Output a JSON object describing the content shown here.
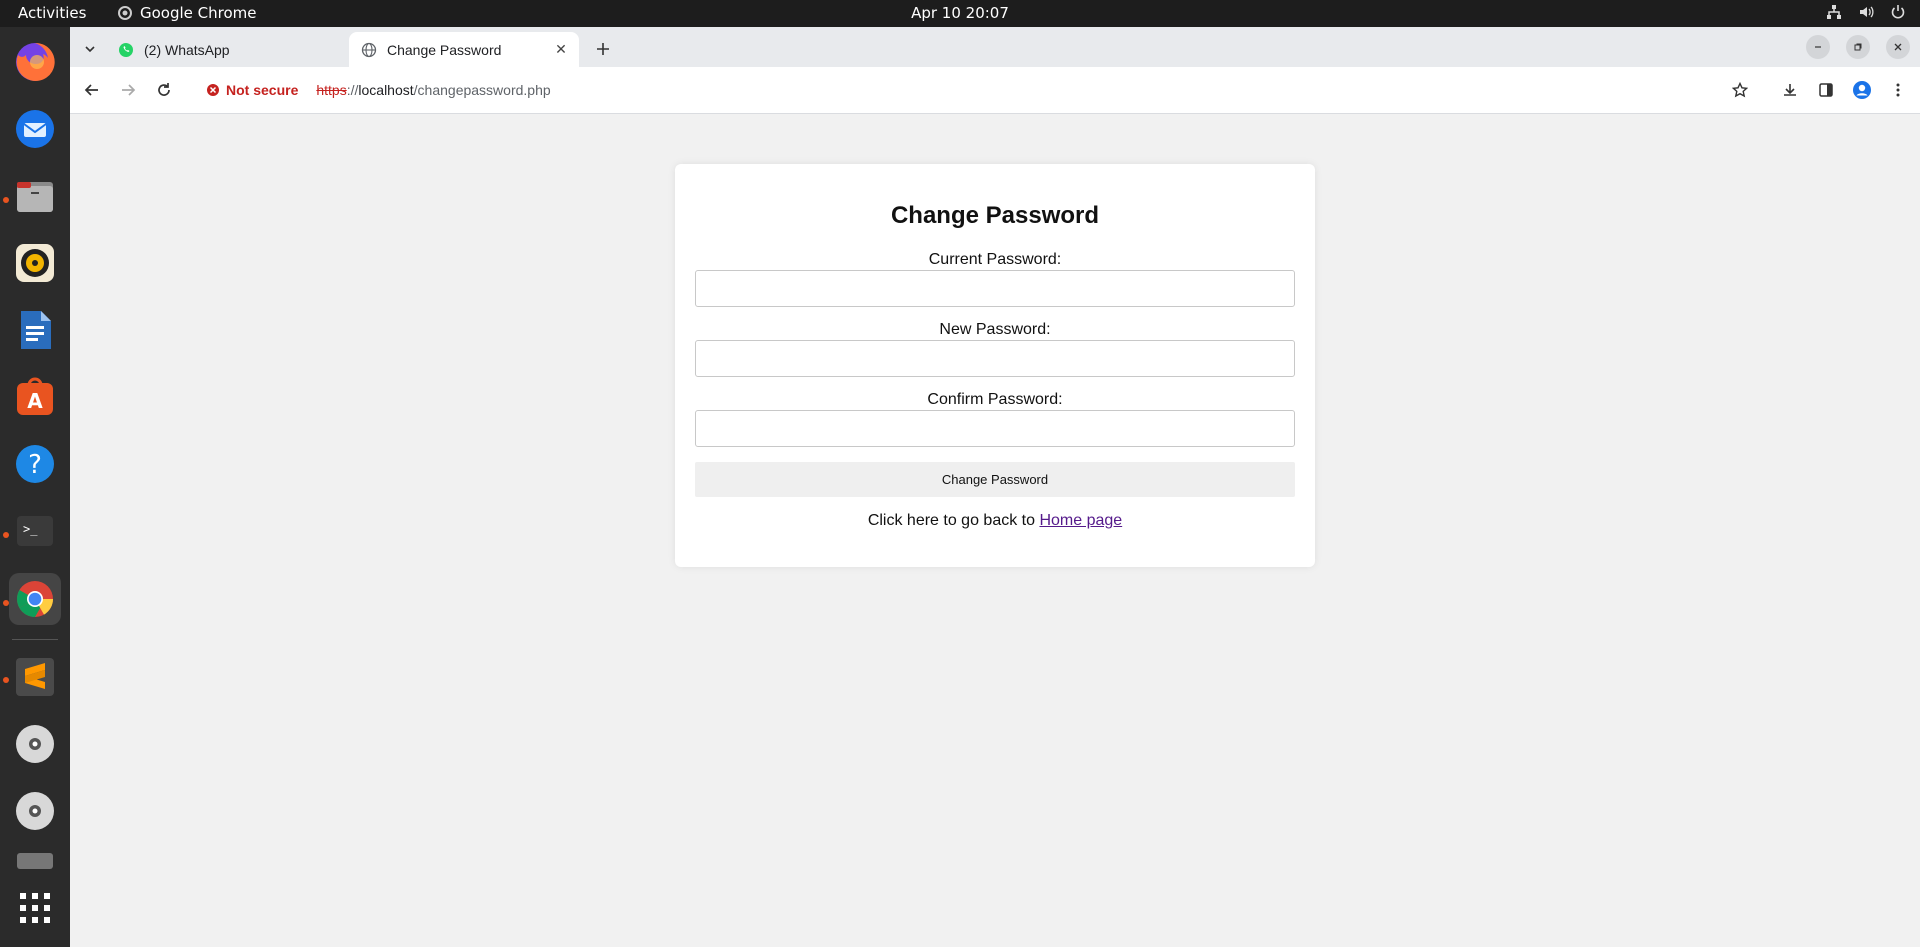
{
  "topbar": {
    "activities": "Activities",
    "app_name": "Google Chrome",
    "clock": "Apr 10  20:07"
  },
  "dock": {
    "items": [
      {
        "name": "firefox-icon"
      },
      {
        "name": "thunderbird-icon"
      },
      {
        "name": "files-icon"
      },
      {
        "name": "rhythmbox-icon"
      },
      {
        "name": "libreoffice-writer-icon"
      },
      {
        "name": "app-center-icon"
      },
      {
        "name": "help-icon"
      },
      {
        "name": "terminal-icon"
      },
      {
        "name": "chrome-icon"
      },
      {
        "name": "sublime-text-icon"
      },
      {
        "name": "disc-icon"
      },
      {
        "name": "disc-icon"
      },
      {
        "name": "show-apps-icon"
      }
    ]
  },
  "browser": {
    "tabs": [
      {
        "title": "(2) WhatsApp",
        "active": false
      },
      {
        "title": "Change Password",
        "active": true
      }
    ],
    "security_label": "Not secure",
    "url_scheme": "https",
    "url_sep": "://",
    "url_host": "localhost",
    "url_path": "/changepassword.php"
  },
  "form": {
    "title": "Change Password",
    "current_label": "Current Password:",
    "new_label": "New Password:",
    "confirm_label": "Confirm Password:",
    "current_value": "",
    "new_value": "",
    "confirm_value": "",
    "submit_label": "Change Password",
    "back_text": "Click here to go back to ",
    "back_link": "Home page"
  },
  "colors": {
    "not_secure": "#c5221f",
    "link": "#551a8b",
    "page_bg": "#f1f1f1",
    "dock_accent": "#e95420"
  }
}
